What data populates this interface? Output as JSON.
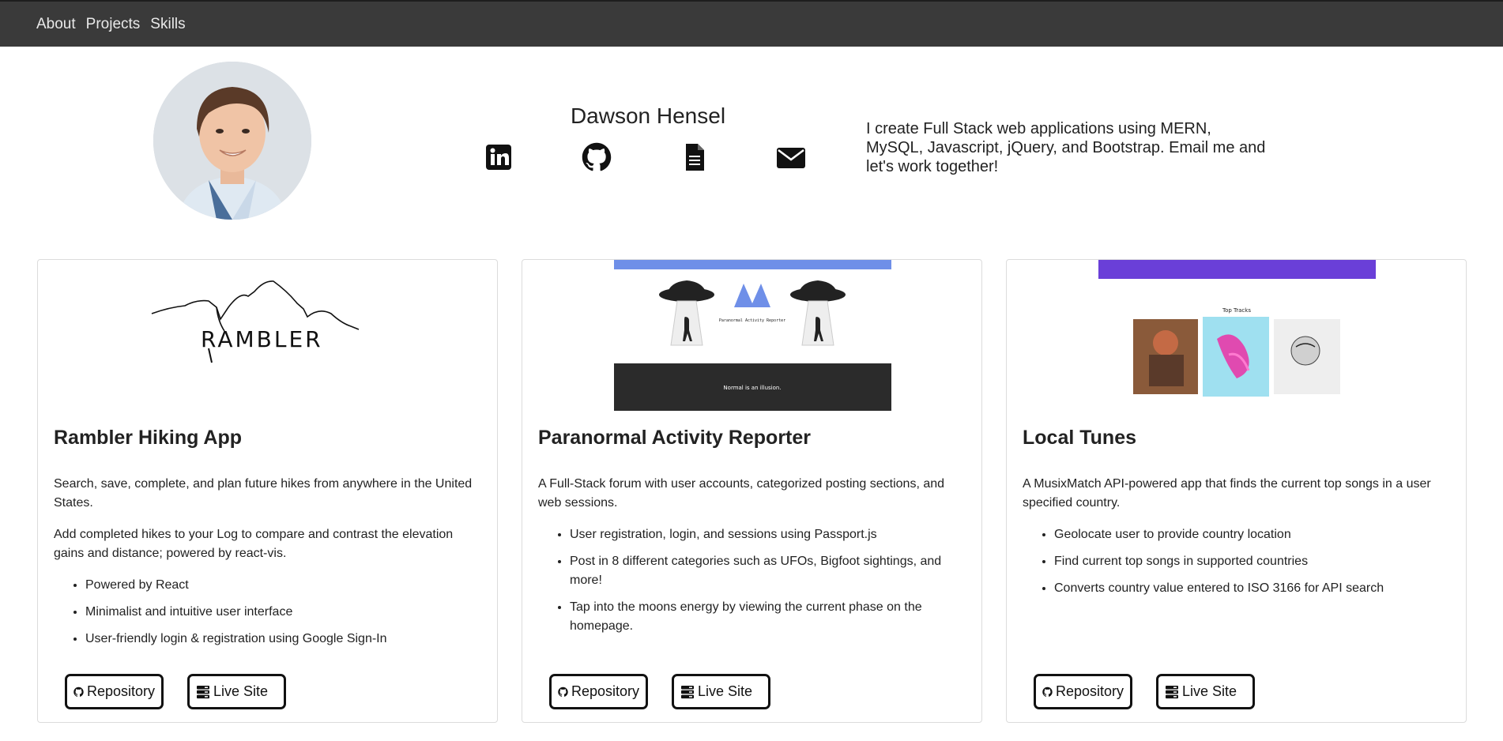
{
  "nav": {
    "items": [
      "About",
      "Projects",
      "Skills"
    ]
  },
  "profile": {
    "name": "Dawson Hensel",
    "bio": "I create Full Stack web applications using MERN, MySQL, Javascript, jQuery, and Bootstrap. Email me and let's work together!",
    "links": [
      {
        "icon": "linkedin-icon"
      },
      {
        "icon": "github-icon"
      },
      {
        "icon": "resume-document-icon"
      },
      {
        "icon": "envelope-icon"
      }
    ]
  },
  "projects": [
    {
      "title": "Rambler Hiking App",
      "image_logo_text": "RAMBLER",
      "paragraphs": [
        "Search, save, complete, and plan future hikes from anywhere in the United States.",
        "Add completed hikes to your Log to compare and contrast the elevation gains and distance; powered by react-vis."
      ],
      "bullets": [
        "Powered by React",
        "Minimalist and intuitive user interface",
        "User-friendly login & registration using Google Sign-In"
      ],
      "repo_label": "Repository",
      "live_label": "Live Site"
    },
    {
      "title": "Paranormal Activity Reporter",
      "image_subtitle": "Paranormal Activity Reporter",
      "image_banner": "Normal is an illusion.",
      "paragraphs": [
        "A Full-Stack forum with user accounts, categorized posting sections, and web sessions."
      ],
      "bullets": [
        "User registration, login, and sessions using Passport.js",
        "Post in 8 different categories such as UFOs, Bigfoot sightings, and more!",
        "Tap into the moons energy by viewing the current phase on the homepage."
      ],
      "repo_label": "Repository",
      "live_label": "Live Site"
    },
    {
      "title": "Local Tunes",
      "image_heading": "Top Tracks",
      "paragraphs": [
        "A MusixMatch API-powered app that finds the current top songs in a user specified country."
      ],
      "bullets": [
        "Geolocate user to provide country location",
        "Find current top songs in supported countries",
        "Converts country value entered to ISO 3166 for API search"
      ],
      "repo_label": "Repository",
      "live_label": "Live Site"
    }
  ],
  "colors": {
    "navbar": "#3a3a3a",
    "paranormal_header": "#6f8fe8",
    "localtunes_header": "#6a3fd8",
    "button_border": "#111111"
  }
}
